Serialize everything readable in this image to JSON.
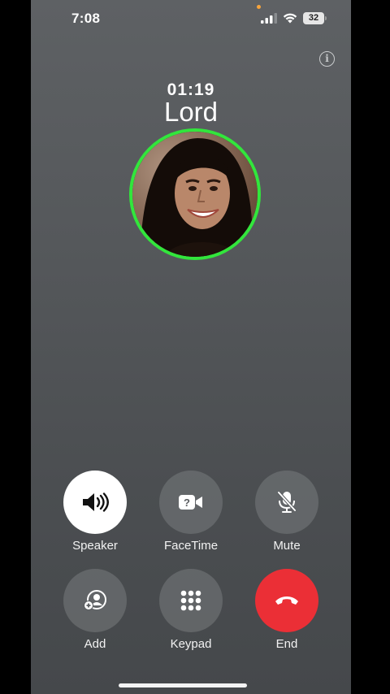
{
  "status_bar": {
    "time": "7:08",
    "battery": "32"
  },
  "call": {
    "duration": "01:19",
    "caller_name": "Lord"
  },
  "controls": {
    "speaker": "Speaker",
    "facetime": "FaceTime",
    "mute": "Mute",
    "add": "Add",
    "keypad": "Keypad",
    "end": "End"
  },
  "colors": {
    "end_red": "#eb2f36",
    "avatar_ring": "#32e63c",
    "active_button": "#ffffff"
  },
  "icons": [
    "info-icon",
    "speaker-icon",
    "facetime-icon",
    "mute-icon",
    "add-contact-icon",
    "keypad-icon",
    "end-call-icon"
  ]
}
